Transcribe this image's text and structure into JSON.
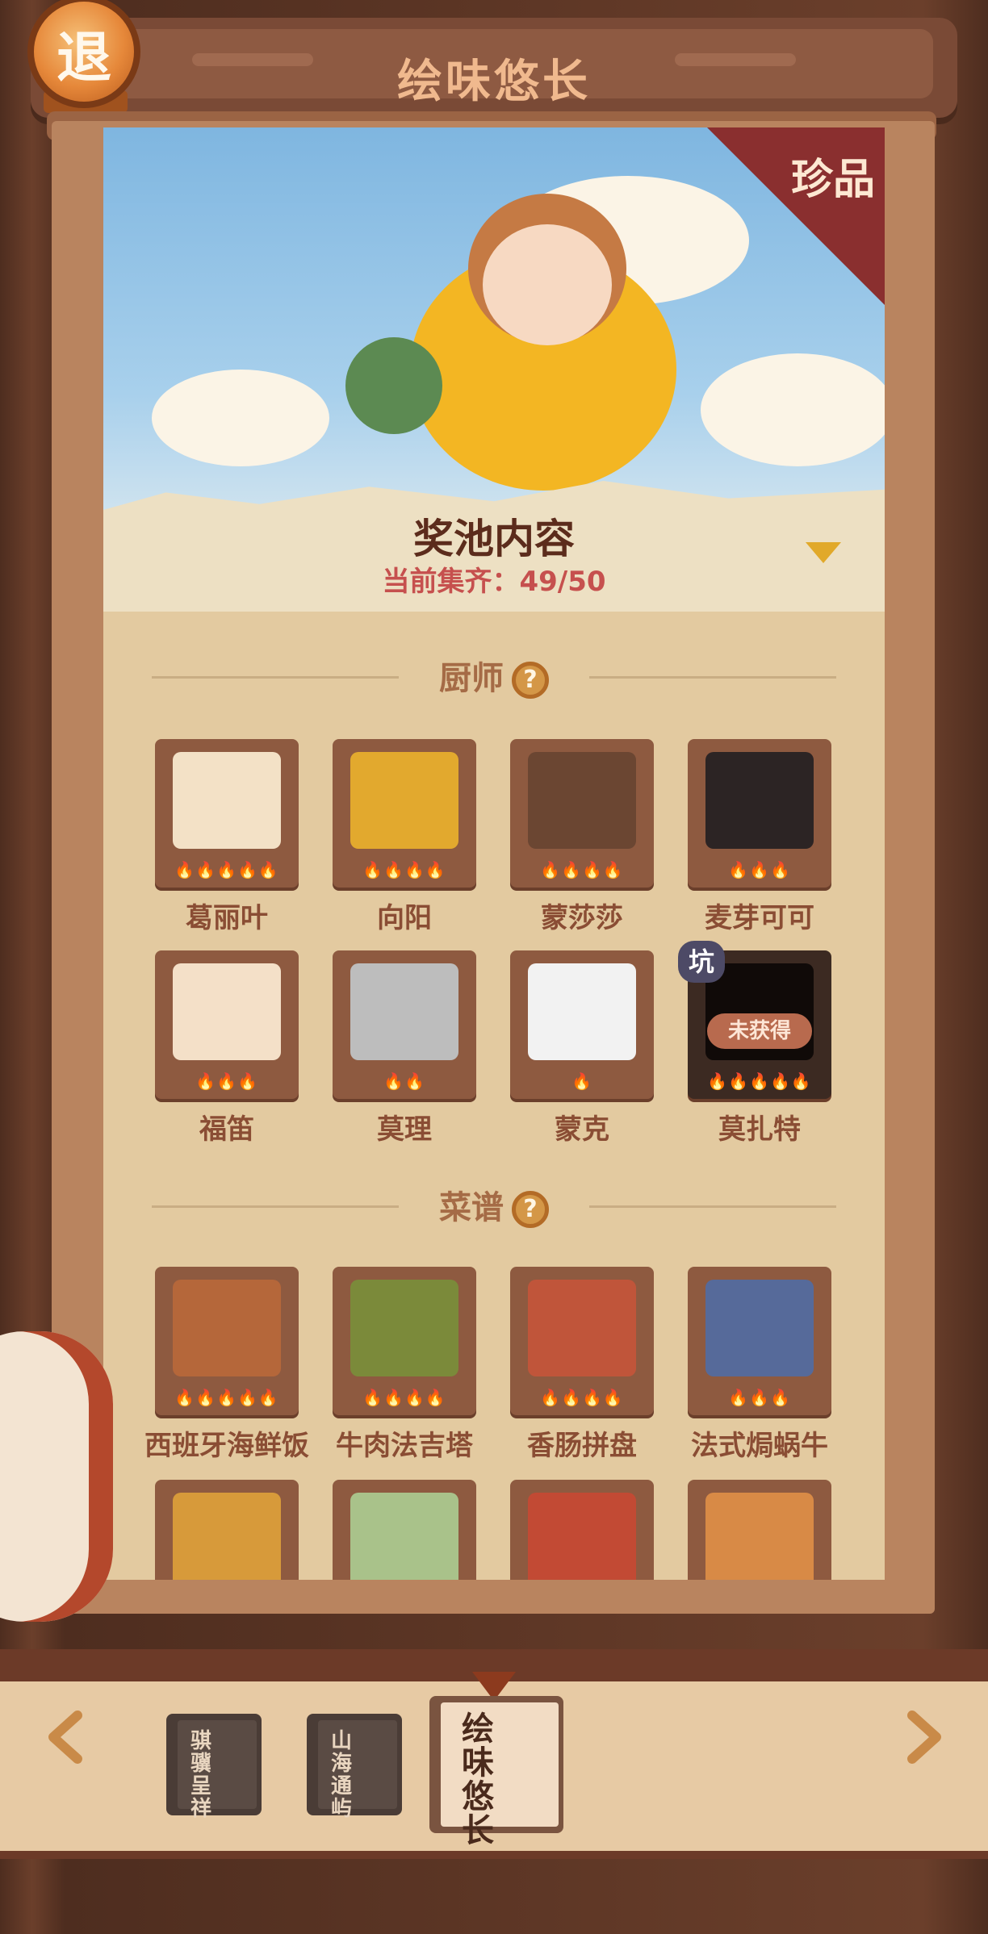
{
  "header": {
    "title": "绘味悠长",
    "exit_label": "退"
  },
  "banner": {
    "rare_tag": "珍品"
  },
  "pool": {
    "title": "奖池内容",
    "progress": "当前集齐：49/50"
  },
  "sections": {
    "chefs": "厨师",
    "recipes": "菜谱",
    "help": "?"
  },
  "chefs": [
    {
      "name": "葛丽叶",
      "stars": "🔥🔥🔥🔥🔥"
    },
    {
      "name": "向阳",
      "stars": "🔥🔥🔥🔥"
    },
    {
      "name": "蒙莎莎",
      "stars": "🔥🔥🔥🔥"
    },
    {
      "name": "麦芽可可",
      "stars": "🔥🔥🔥"
    },
    {
      "name": "福笛",
      "stars": "🔥🔥🔥"
    },
    {
      "name": "莫理",
      "stars": "🔥🔥"
    },
    {
      "name": "蒙克",
      "stars": "🔥"
    },
    {
      "name": "莫扎特",
      "stars": "🔥🔥🔥🔥🔥",
      "badge": "坑",
      "status": "未获得"
    }
  ],
  "recipes": [
    {
      "name": "西班牙海鲜饭",
      "stars": "🔥🔥🔥🔥🔥"
    },
    {
      "name": "牛肉法吉塔",
      "stars": "🔥🔥🔥🔥"
    },
    {
      "name": "香肠拼盘",
      "stars": "🔥🔥🔥🔥"
    },
    {
      "name": "法式焗蜗牛",
      "stars": "🔥🔥🔥"
    }
  ],
  "books": [
    {
      "title": "骐骥呈祥"
    },
    {
      "title": "山海通屿"
    },
    {
      "title": "绘味悠长"
    }
  ],
  "colors": {
    "accent": "#e1a92a",
    "progress": "#c6504e",
    "title": "#5c2c1c"
  }
}
